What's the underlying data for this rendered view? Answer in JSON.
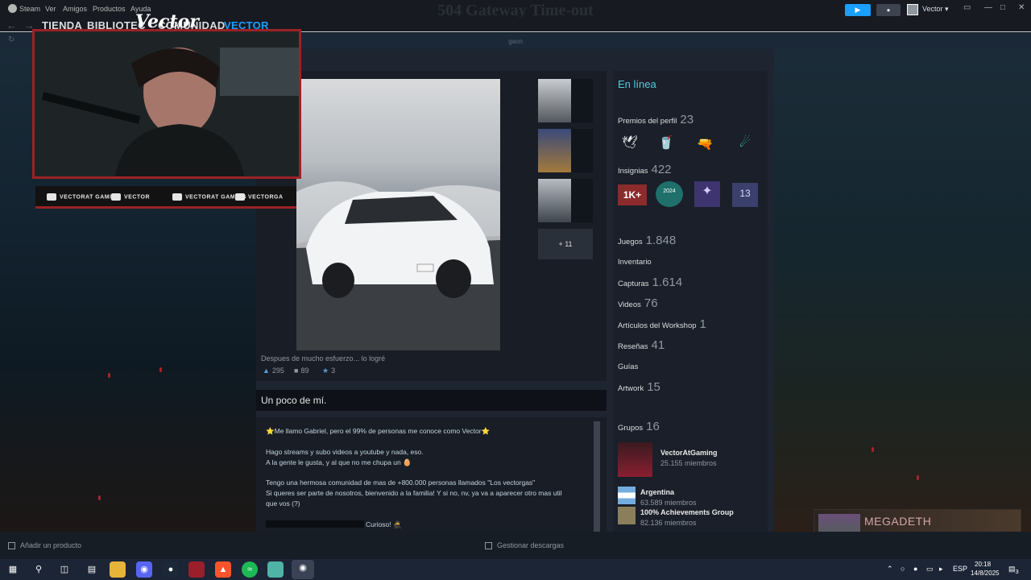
{
  "menu": [
    "Steam",
    "Ver",
    "Amigos",
    "Productos",
    "Ayuda"
  ],
  "error_title": "504 Gateway Time-out",
  "user": {
    "name": "Vector"
  },
  "nav_tabs": [
    "TIENDA",
    "BIBLIOTEC",
    "COMUNIDAD",
    "VECTOR"
  ],
  "url_text": "gaon",
  "overlay": {
    "logo": "Vector",
    "socials": [
      "VECTORAT GAMING",
      "VECTOR",
      "VECTORAT GAMING",
      "VECTORGA"
    ]
  },
  "showcase": {
    "more": "+ 11",
    "caption": "Despues de mucho esfuerzo... lo logré",
    "likes": "295",
    "comments": "89",
    "awards": "3"
  },
  "about": {
    "title": "Un poco de mí.",
    "lines": [
      "⭐Me llamo Gabriel, pero el 99% de personas me conoce como Vector⭐",
      "Hago streams y subo videos a youtube y nada, eso.",
      "A la gente le gusta, y al que no me chupa un 🥚",
      "Tengo una hermosa comunidad de mas de +800.000 personas llamados \"Los vectorgas\"",
      "Si queres ser parte de nosotros, bienvenido a la familia! Y si no, nv, ya va a aparecer otro mas util",
      "que vos (?)",
      "Curioso! 🥷"
    ]
  },
  "sidebar": {
    "online": "En línea",
    "awards_label": "Premios del perfil",
    "awards_count": "23",
    "award_icons": [
      "🕊",
      "🥤",
      "🔫",
      "☄"
    ],
    "badges_label": "Insignias",
    "badges_count": "422",
    "badge_icons": [
      {
        "label": "1K+",
        "color": "#8c2b2b"
      },
      {
        "label": "2024",
        "color": "#1f6f6a"
      },
      {
        "label": "✦",
        "color": "#3d3470"
      },
      {
        "label": "13",
        "color": "#3a3f6b"
      }
    ],
    "stats": [
      {
        "label": "Juegos",
        "value": "1.848"
      },
      {
        "label": "Inventario",
        "value": ""
      },
      {
        "label": "Capturas",
        "value": "1.614"
      },
      {
        "label": "Videos",
        "value": "76"
      },
      {
        "label": "Artículos del Workshop",
        "value": "1"
      },
      {
        "label": "Reseñas",
        "value": "41"
      },
      {
        "label": "Guías",
        "value": ""
      },
      {
        "label": "Artwork",
        "value": "15"
      }
    ],
    "groups_label": "Grupos",
    "groups_count": "16",
    "groups": [
      {
        "name": "VectorAtGaming",
        "members": "25.155 miembros"
      },
      {
        "name": "Argentina",
        "members": "63.589 miembros"
      },
      {
        "name": "100% Achievements Group",
        "members": "82.136 miembros"
      }
    ]
  },
  "music": {
    "artist": "MEGADETH"
  },
  "bottom": {
    "add_product": "Añadir un producto",
    "downloads": "Gestionar descargas"
  },
  "taskbar": {
    "lang": "ESP",
    "time": "20:18",
    "date": "14/8/2025",
    "notif": "3"
  }
}
